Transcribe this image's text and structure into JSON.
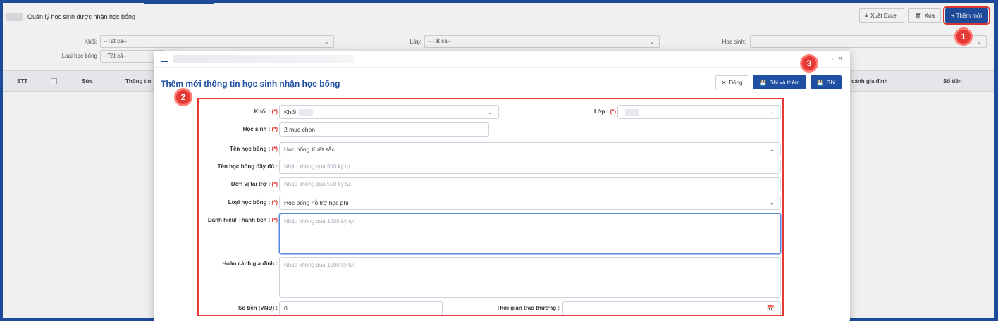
{
  "page": {
    "title": ". Quản lý học sinh được nhận học bổng",
    "actions": {
      "export": "Xuất Excel",
      "delete": "Xóa",
      "add": "+ Thêm mới"
    }
  },
  "filters": {
    "khoi_label": "Khối:",
    "khoi_value": "--Tất cả--",
    "lop_label": "Lớp:",
    "lop_value": "--Tất cả--",
    "hocsinh_label": "Học sinh:",
    "loai_label": "Loại học bổng",
    "loai_value": "--Tất cả--"
  },
  "grid": {
    "columns": {
      "stt": "STT",
      "sua": "Sửa",
      "thongtin": "Thông tin",
      "hoancanh": "cảnh gia đình",
      "sotien": "Số tiền"
    }
  },
  "modal": {
    "title": "Thêm mới thông tin học sinh nhận học bổng",
    "buttons": {
      "close": "Đóng",
      "save_add": "Ghi và thêm",
      "save": "Ghi"
    },
    "required_mark": "(*)",
    "fields": {
      "khoi": {
        "label": "Khối :",
        "value": "Khối"
      },
      "lop": {
        "label": "Lớp :"
      },
      "hocsinh": {
        "label": "Học sinh :",
        "value": "2 mục chọn"
      },
      "tenhocbong": {
        "label": "Tên học bổng :",
        "value": "Học bổng Xuất sắc"
      },
      "tendaydu": {
        "label": "Tên học bổng đầy đủ :",
        "placeholder": "Nhập không quá 500 ký tự."
      },
      "donvi": {
        "label": "Đơn vị tài trợ :",
        "placeholder": "Nhập không quá 500 ký tự."
      },
      "loaihocbong": {
        "label": "Loại học bổng :",
        "value": "Học bổng hỗ trợ học phí"
      },
      "danhhieu": {
        "label": "Danh hiệu/ Thành tích :",
        "placeholder": "Nhập không quá 1000 ký tự."
      },
      "hoancanh": {
        "label": "Hoàn cảnh gia đình :",
        "placeholder": "Nhập không quá 1000 ký tự."
      },
      "sotien": {
        "label": "Số tiền (VNĐ) :",
        "value": "0"
      },
      "thoigian": {
        "label": "Thời gian trao thưởng :"
      }
    }
  },
  "annotations": {
    "step1": "1",
    "step2": "2",
    "step3": "3"
  },
  "colors": {
    "primary": "#1f4fa3",
    "highlight": "#e53935"
  }
}
